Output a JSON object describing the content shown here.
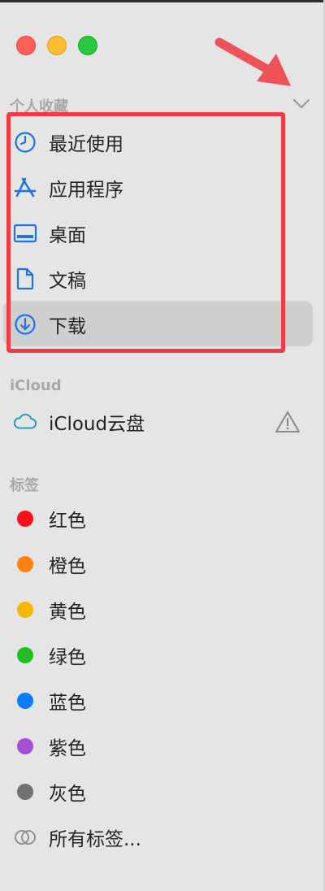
{
  "sections": {
    "favorites": "个人收藏",
    "icloud": "iCloud",
    "tags": "标签"
  },
  "favorites": {
    "recent": "最近使用",
    "applications": "应用程序",
    "desktop": "桌面",
    "documents": "文稿",
    "downloads": "下载"
  },
  "icloud": {
    "drive": "iCloud云盘"
  },
  "tags": {
    "red": "红色",
    "orange": "橙色",
    "yellow": "黄色",
    "green": "绿色",
    "blue": "蓝色",
    "purple": "紫色",
    "gray": "灰色",
    "all": "所有标签..."
  },
  "colors": {
    "accent": "#1a73e8",
    "tag_red": "#ff0f1a",
    "tag_orange": "#ff7f0f",
    "tag_yellow": "#f5b800",
    "tag_green": "#1fbf1f",
    "tag_blue": "#0a7aff",
    "tag_purple": "#a64fd6",
    "tag_gray": "#707075",
    "highlight_box": "#ee3b45"
  }
}
